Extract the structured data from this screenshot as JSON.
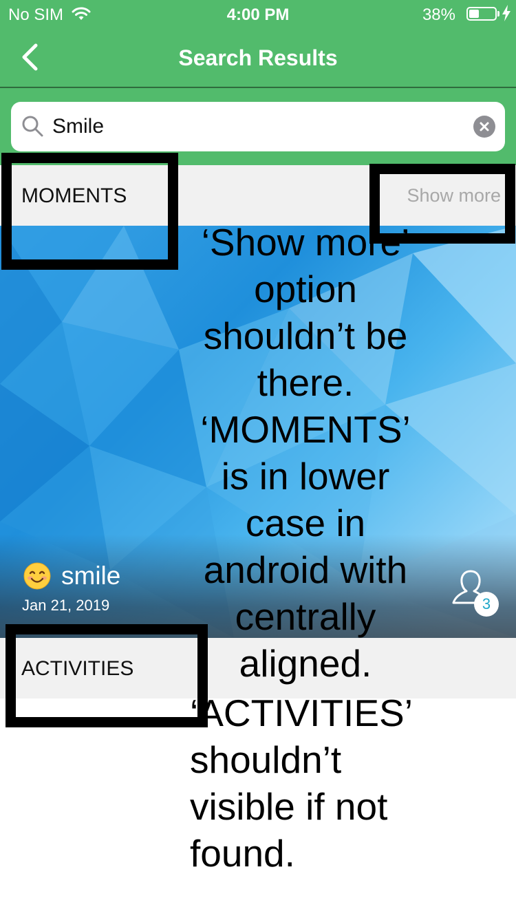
{
  "status_bar": {
    "carrier": "No SIM",
    "time": "4:00 PM",
    "battery_percent": "38%",
    "battery_level": 0.38,
    "icons": [
      "wifi-icon",
      "battery-icon",
      "charging-bolt-icon"
    ]
  },
  "nav": {
    "title": "Search Results",
    "back_icon": "chevron-left-icon"
  },
  "search": {
    "value": "Smile",
    "placeholder": "",
    "icons": [
      "search-icon",
      "clear-icon"
    ]
  },
  "moments": {
    "header": "MOMENTS",
    "show_more": "Show more",
    "item": {
      "emoji": "😊",
      "name": "smile",
      "date": "Jan 21, 2019",
      "participants": "3",
      "icon": "user-outline-icon"
    }
  },
  "activities": {
    "header": "ACTIVITIES"
  },
  "annotation": {
    "text_block_1": "‘Show more’ option shouldn’t be there. ‘MOMENTS’ is in lower case in android with centrally aligned.",
    "text_block_2": "‘ACTIVITIES’ shouldn’t visible if not found.",
    "colors": {
      "highlight_border": "#000000",
      "header_green": "#52bb6c",
      "section_bg": "#f1f1f1"
    }
  }
}
